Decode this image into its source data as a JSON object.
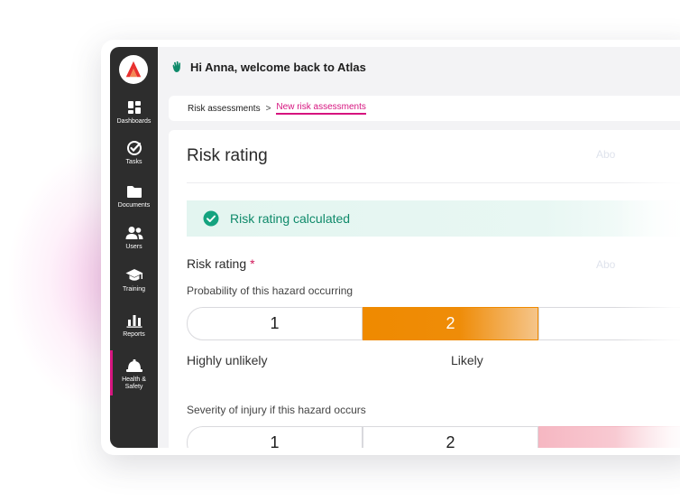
{
  "topbar": {
    "greeting": "Hi Anna, welcome back to Atlas"
  },
  "sidebar": {
    "items": [
      {
        "label": "Dashboards",
        "icon": "dashboards-icon"
      },
      {
        "label": "Tasks",
        "icon": "tasks-icon"
      },
      {
        "label": "Documents",
        "icon": "folder-icon"
      },
      {
        "label": "Users",
        "icon": "users-icon"
      },
      {
        "label": "Training",
        "icon": "graduation-cap-icon"
      },
      {
        "label": "Reports",
        "icon": "bar-chart-icon"
      },
      {
        "label": "Health &\nSafety",
        "icon": "hard-hat-icon",
        "active": true
      }
    ]
  },
  "breadcrumb": {
    "parent": "Risk assessments",
    "separator": ">",
    "current": "New risk assessments"
  },
  "panel": {
    "title": "Risk rating",
    "about_link": "Abo",
    "alert": "Risk rating calculated",
    "rating_label": "Risk rating",
    "required_mark": "*",
    "about_link_2": "Abo",
    "probability": {
      "question": "Probability of this hazard occurring",
      "options": [
        "1",
        "2",
        ""
      ],
      "selected": "2",
      "scale_labels": [
        "Highly unlikely",
        "Likely"
      ]
    },
    "severity": {
      "question": "Severity of injury if this hazard occurs",
      "options": [
        "1",
        "2",
        ""
      ]
    }
  },
  "colors": {
    "accent": "#d6147f",
    "sidebar": "#2d2d2d",
    "success": "#0f8a6a",
    "selected": "#ef8a00"
  }
}
